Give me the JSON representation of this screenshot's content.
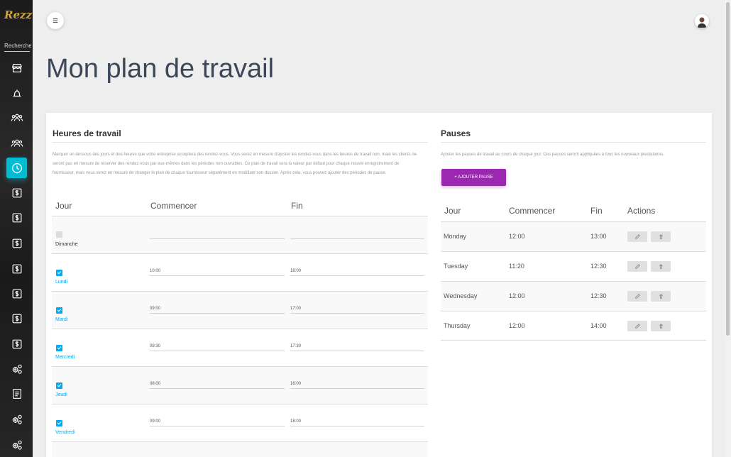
{
  "brand": {
    "logo_text": "Rezz"
  },
  "sidebar": {
    "search_label": "Recherche",
    "items": [
      {
        "icon": "store-icon"
      },
      {
        "icon": "bell-icon"
      },
      {
        "icon": "users-icon"
      },
      {
        "icon": "users-icon"
      },
      {
        "icon": "clock-icon",
        "active": true
      },
      {
        "icon": "dollar-icon"
      },
      {
        "icon": "dollar-icon"
      },
      {
        "icon": "dollar-icon"
      },
      {
        "icon": "dollar-icon"
      },
      {
        "icon": "dollar-icon"
      },
      {
        "icon": "dollar-icon"
      },
      {
        "icon": "gears-icon"
      },
      {
        "icon": "book-icon"
      },
      {
        "icon": "gears-icon"
      },
      {
        "icon": "gears-icon"
      }
    ]
  },
  "page": {
    "title": "Mon plan de travail"
  },
  "work_hours": {
    "title": "Heures de travail",
    "description": "Marquer en dessous des jours et des heures que votre entreprise acceptera des rendez-vous. Vous serez en mesure d'ajuster les rendez-vous dans les heures de travail non, mais les clients ne seront pas en mesure de réserver des rendez-vous par eux-mêmes dans les périodes non ouvrables. Ce plan de travail sera la valeur par défaut pour chaque nouvel enregistrement de fournisseur, mais vous serez en mesure de changer le plan de chaque fournisseur séparément en modifiant son dossier. Après cela, vous pouvez ajouter des périodes de pause.",
    "headers": {
      "day": "Jour",
      "start": "Commencer",
      "end": "Fin"
    },
    "days": [
      {
        "day": "Dimanche",
        "checked": false,
        "start": "",
        "end": ""
      },
      {
        "day": "Lundi",
        "checked": true,
        "start": "10:00",
        "end": "18:00"
      },
      {
        "day": "Mardi",
        "checked": true,
        "start": "09:00",
        "end": "17:00"
      },
      {
        "day": "Mercredi",
        "checked": true,
        "start": "09:30",
        "end": "17:30"
      },
      {
        "day": "Jeudi",
        "checked": true,
        "start": "08:00",
        "end": "16:00"
      },
      {
        "day": "Vendredi",
        "checked": true,
        "start": "09:00",
        "end": "18:00"
      }
    ]
  },
  "pauses": {
    "title": "Pauses",
    "description": "Ajouter les pauses de travail au cours de chaque jour. Ces pauses seront appliquées à tous les nouveaux prestataires.",
    "add_button": "+ AJOUTER PAUSE",
    "headers": {
      "day": "Jour",
      "start": "Commencer",
      "end": "Fin",
      "actions": "Actions"
    },
    "rows": [
      {
        "day": "Monday",
        "start": "12:00",
        "end": "13:00"
      },
      {
        "day": "Tuesday",
        "start": "11:20",
        "end": "12:30"
      },
      {
        "day": "Wednesday",
        "start": "12:00",
        "end": "12:30"
      },
      {
        "day": "Thursday",
        "start": "12:00",
        "end": "14:00"
      }
    ]
  },
  "colors": {
    "accent": "#00bcd4",
    "checkbox": "#03a9f4",
    "button": "#9c27b0"
  }
}
